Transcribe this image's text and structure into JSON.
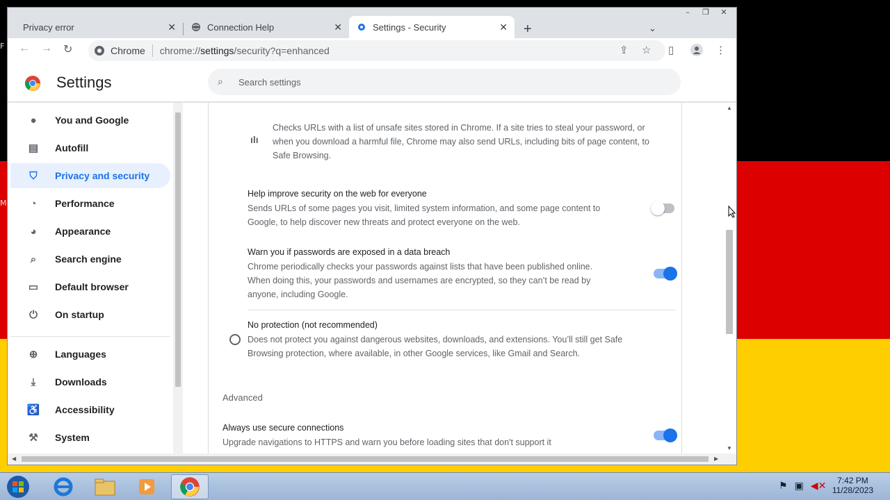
{
  "desktop": {
    "left_letters": [
      "F",
      "M"
    ]
  },
  "window": {
    "controls": [
      "–",
      "❐",
      "✕"
    ]
  },
  "tabs": [
    {
      "title": "Privacy error",
      "icon": "error-icon",
      "active": false
    },
    {
      "title": "Connection Help",
      "icon": "globe-icon",
      "active": false
    },
    {
      "title": "Settings - Security",
      "icon": "gear-icon",
      "active": true
    }
  ],
  "toolbar": {
    "site_label": "Chrome",
    "url_prefix": "chrome://",
    "url_host": "settings",
    "url_path": "/security?q=enhanced"
  },
  "settings": {
    "title": "Settings",
    "search_placeholder": "Search settings"
  },
  "sidebar": {
    "items": [
      {
        "label": "You and Google",
        "icon": "person-icon"
      },
      {
        "label": "Autofill",
        "icon": "clipboard-icon"
      },
      {
        "label": "Privacy and security",
        "icon": "shield-icon",
        "active": true
      },
      {
        "label": "Performance",
        "icon": "speedometer-icon"
      },
      {
        "label": "Appearance",
        "icon": "palette-icon"
      },
      {
        "label": "Search engine",
        "icon": "search-icon"
      },
      {
        "label": "Default browser",
        "icon": "browser-icon"
      },
      {
        "label": "On startup",
        "icon": "power-icon"
      },
      {
        "label": "Languages",
        "icon": "globe-icon"
      },
      {
        "label": "Downloads",
        "icon": "download-icon"
      },
      {
        "label": "Accessibility",
        "icon": "accessibility-icon"
      },
      {
        "label": "System",
        "icon": "wrench-icon"
      }
    ]
  },
  "content": {
    "standard_desc": "Checks URLs with a list of unsafe sites stored in Chrome. If a site tries to steal your password, or",
    "standard_desc2": "when you download a harmful file, Chrome may also send URLs, including bits of page content, to",
    "standard_desc3": "Safe Browsing.",
    "help_improve": {
      "title": "Help improve security on the web for everyone",
      "desc1": "Sends URLs of some pages you visit, limited system information, and some page content to",
      "desc2": "Google, to help discover new threats and protect everyone on the web.",
      "enabled": false
    },
    "password_warn": {
      "title": "Warn you if passwords are exposed in a data breach",
      "desc1": "Chrome periodically checks your passwords against lists that have been published online.",
      "desc2": "When doing this, your passwords and usernames are encrypted, so they can’t be read by",
      "desc3": "anyone, including Google.",
      "enabled": true
    },
    "no_protection": {
      "title": "No protection (not recommended)",
      "desc1": "Does not protect you against dangerous websites, downloads, and extensions. You’ll still get Safe",
      "desc2": "Browsing protection, where available, in other Google services, like Gmail and Search.",
      "selected": false
    },
    "advanced_label": "Advanced",
    "secure_connections": {
      "title": "Always use secure connections",
      "desc": "Upgrade navigations to HTTPS and warn you before loading sites that don't support it",
      "enabled": true
    }
  },
  "taskbar": {
    "time": "7:42 PM",
    "date": "11/28/2023"
  },
  "colors": {
    "accent": "#1a73e8",
    "active_bg": "#e8f0fe"
  }
}
